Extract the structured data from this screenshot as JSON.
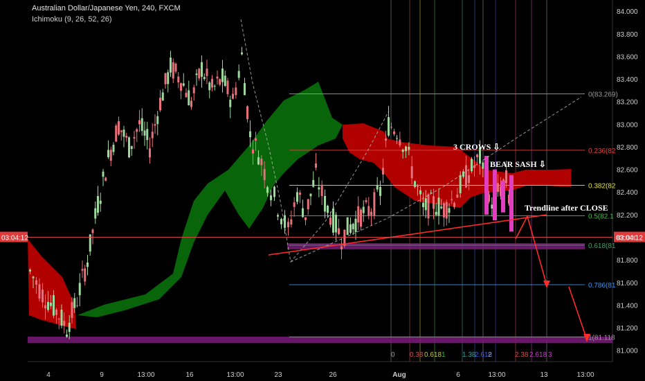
{
  "chart_data": {
    "type": "candlestick",
    "title": "Australian Dollar/Japanese Yen, 240, FXCM",
    "indicator": "Ichimoku (9, 26, 52, 26)",
    "y_ticks": [
      "84.000",
      "83.800",
      "83.600",
      "83.400",
      "83.200",
      "83.000",
      "82.800",
      "82.600",
      "82.400",
      "82.200",
      "82.000",
      "81.800",
      "81.600",
      "81.400",
      "81.200",
      "81.000"
    ],
    "ylim": [
      80.9,
      84.05
    ],
    "x_ticks": [
      "4",
      "9",
      "13:00",
      "16",
      "13:00",
      "23",
      "26",
      "Aug",
      "6",
      "13:00",
      "13",
      "13:00"
    ],
    "current_price_label": "03:04:12",
    "current_price": 82.0,
    "fib_levels": [
      {
        "label": "0(83.269)",
        "value": 83.269,
        "color": "#9a9a9a"
      },
      {
        "label": "0.236(82",
        "value": 82.77,
        "color": "#e04040"
      },
      {
        "label": "0.382(82",
        "value": 82.46,
        "color": "#e0e040"
      },
      {
        "label": "0.5(82.1",
        "value": 82.19,
        "color": "#40c040"
      },
      {
        "label": "0.618(81",
        "value": 81.93,
        "color": "#40a060"
      },
      {
        "label": "0.786(81",
        "value": 81.58,
        "color": "#4090e0"
      },
      {
        "label": "1(81.118",
        "value": 81.118,
        "color": "#9a9a9a"
      }
    ],
    "fib_time_labels": [
      "0",
      "0.38",
      "0.618",
      "1",
      "1.38",
      "2.618",
      "2",
      "2.38",
      "2.618",
      "3"
    ],
    "annotations": {
      "crows": "3 CROWS ⇩",
      "sash": "BEAR SASH ⇩",
      "trendline": "Trendline after CLOSE"
    },
    "colors": {
      "up": "#9dd99d",
      "down": "#e8707a",
      "kumo_bull": "#0a6a0a",
      "kumo_bear": "#b00000",
      "support": "#7a1a7a"
    }
  }
}
